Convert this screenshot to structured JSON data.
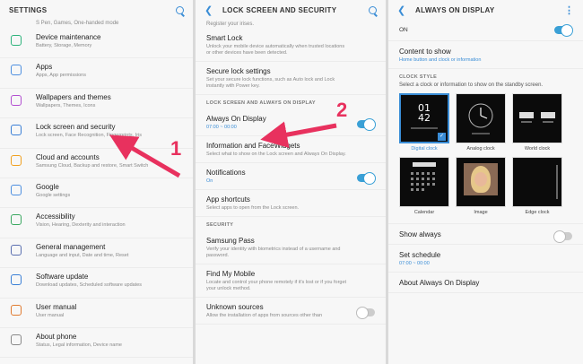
{
  "panel1": {
    "title": "SETTINGS",
    "top_cut_text": "S Pen, Games, One-handed mode",
    "items": [
      {
        "label": "Device maintenance",
        "sub": "Battery, Storage, Memory",
        "icon": "device-maintenance-icon",
        "color": "#2db37a"
      },
      {
        "label": "Apps",
        "sub": "Apps, App permissions",
        "icon": "apps-icon",
        "color": "#4d8fe0"
      },
      {
        "label": "Wallpapers and themes",
        "sub": "Wallpapers, Themes, Icons",
        "icon": "brush-icon",
        "color": "#b24fd0"
      },
      {
        "label": "Lock screen and security",
        "sub": "Lock screen, Face Recognition, Fingerprints, Iris",
        "icon": "lock-icon",
        "color": "#3a7fd6"
      },
      {
        "label": "Cloud and accounts",
        "sub": "Samsung Cloud, Backup and restore, Smart Switch",
        "icon": "key-icon",
        "color": "#f0a020"
      },
      {
        "label": "Google",
        "sub": "Google settings",
        "icon": "google-icon",
        "color": "#4d8fe0"
      },
      {
        "label": "Accessibility",
        "sub": "Vision, Hearing, Dexterity and interaction",
        "icon": "accessibility-icon",
        "color": "#3aa860"
      },
      {
        "label": "General management",
        "sub": "Language and input, Date and time, Reset",
        "icon": "sliders-icon",
        "color": "#5a6fb0"
      },
      {
        "label": "Software update",
        "sub": "Download updates, Scheduled software updates",
        "icon": "update-icon",
        "color": "#3a7fd6"
      },
      {
        "label": "User manual",
        "sub": "User manual",
        "icon": "manual-icon",
        "color": "#e07a30"
      },
      {
        "label": "About phone",
        "sub": "Status, Legal information, Device name",
        "icon": "info-icon",
        "color": "#888888"
      }
    ]
  },
  "panel2": {
    "title": "LOCK SCREEN AND SECURITY",
    "top_cut_text": "Register your irises.",
    "items_a": [
      {
        "label": "Smart Lock",
        "sub": "Unlock your mobile device automatically when trusted locations or other devices have been detected."
      },
      {
        "label": "Secure lock settings",
        "sub": "Set your secure lock functions, such as Auto lock and Lock instantly with Power key."
      }
    ],
    "section_a": "LOCK SCREEN AND ALWAYS ON DISPLAY",
    "items_b": [
      {
        "label": "Always On Display",
        "sub": "07:00 ~ 00:00"
      },
      {
        "label": "Information and FaceWidgets",
        "sub": "Select what to show on the Lock screen and Always On Display."
      },
      {
        "label": "Notifications",
        "sub": "On"
      },
      {
        "label": "App shortcuts",
        "sub": "Select apps to open from the Lock screen."
      }
    ],
    "section_b": "SECURITY",
    "items_c": [
      {
        "label": "Samsung Pass",
        "sub": "Verify your identity with biometrics instead of a username and password."
      },
      {
        "label": "Find My Mobile",
        "sub": "Locate and control your phone remotely if it's lost or if you forget your unlock method."
      },
      {
        "label": "Unknown sources",
        "sub": "Allow the installation of apps from sources other than"
      }
    ]
  },
  "panel3": {
    "title": "ALWAYS ON DISPLAY",
    "on_label": "ON",
    "content_label": "Content to show",
    "content_value": "Home button and clock or information",
    "clock_style_head": "CLOCK STYLE",
    "clock_style_desc": "Select a clock or information to show on the standby screen.",
    "styles": [
      "Digital clock",
      "Analog clock",
      "World clock",
      "Calendar",
      "Image",
      "Edge clock"
    ],
    "digital_time_h": "01",
    "digital_time_m": "42",
    "show_always": "Show always",
    "schedule_label": "Set schedule",
    "schedule_value": "07:00 ~ 00:00",
    "about": "About Always On Display"
  },
  "callouts": {
    "one": "1",
    "two": "2"
  },
  "colors": {
    "accent": "#3a8dd6",
    "arrow": "#e8315e"
  }
}
